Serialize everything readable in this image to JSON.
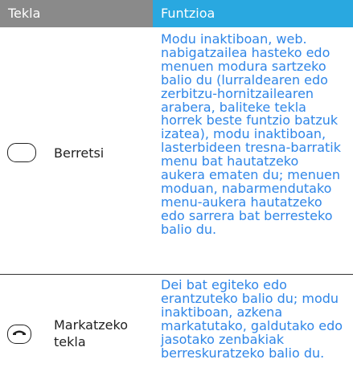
{
  "header": {
    "key_col": "Tekla",
    "func_col": "Funtzioa"
  },
  "rows": [
    {
      "icon": "confirm-key-icon",
      "key_label": "Berretsi",
      "description": "Modu inaktiboan, web. nabigatzailea hasteko edo menuen modura sartzeko balio du (lurraldearen edo zerbitzu-hornitzailearen arabera, baliteke tekla horrek beste funtzio batzuk izatea), modu inaktiboan, lasterbideen tresna-barratik menu bat hautatzeko aukera ematen du; menuen moduan, nabarmendutako menu-aukera hautatzeko edo sarrera bat berresteko balio du."
    },
    {
      "icon": "call-key-icon",
      "key_label": "Markatzeko tekla",
      "description": "Dei bat egiteko edo erantzuteko balio du; modu inaktiboan, azkena markatutako, galdutako edo jasotako zenbakiak berreskuratzeko balio du."
    }
  ],
  "colors": {
    "header_key_bg": "#8a8a8a",
    "header_func_bg": "#29a8e0",
    "description_text": "#2f86e8"
  }
}
